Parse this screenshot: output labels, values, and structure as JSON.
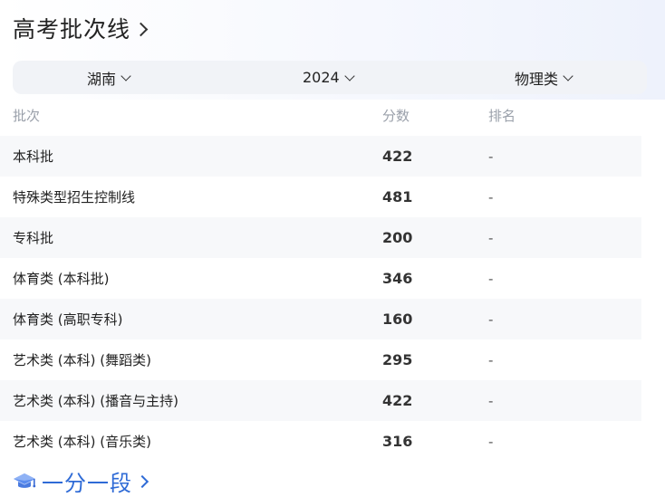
{
  "header": {
    "title": "高考批次线"
  },
  "filters": {
    "province": "湖南",
    "year": "2024",
    "subject": "物理类"
  },
  "columns": {
    "batch": "批次",
    "score": "分数",
    "rank": "排名"
  },
  "rows": [
    {
      "batch": "本科批",
      "score": "422",
      "rank": "-"
    },
    {
      "batch": "特殊类型招生控制线",
      "score": "481",
      "rank": "-"
    },
    {
      "batch": "专科批",
      "score": "200",
      "rank": "-"
    },
    {
      "batch": "体育类 (本科批)",
      "score": "346",
      "rank": "-"
    },
    {
      "batch": "体育类 (高职专科)",
      "score": "160",
      "rank": "-"
    },
    {
      "batch": "艺术类 (本科) (舞蹈类)",
      "score": "295",
      "rank": "-"
    },
    {
      "batch": "艺术类 (本科) (播音与主持)",
      "score": "422",
      "rank": "-"
    },
    {
      "batch": "艺术类 (本科) (音乐类)",
      "score": "316",
      "rank": "-"
    }
  ],
  "footer": {
    "link_label": "一分一段",
    "icon": "graduation-cap-icon"
  },
  "colors": {
    "link": "#2f6bd6",
    "filter_bg": "#f1f3f7",
    "row_shade": "#f7f8fa",
    "muted": "#9aa0aa"
  }
}
